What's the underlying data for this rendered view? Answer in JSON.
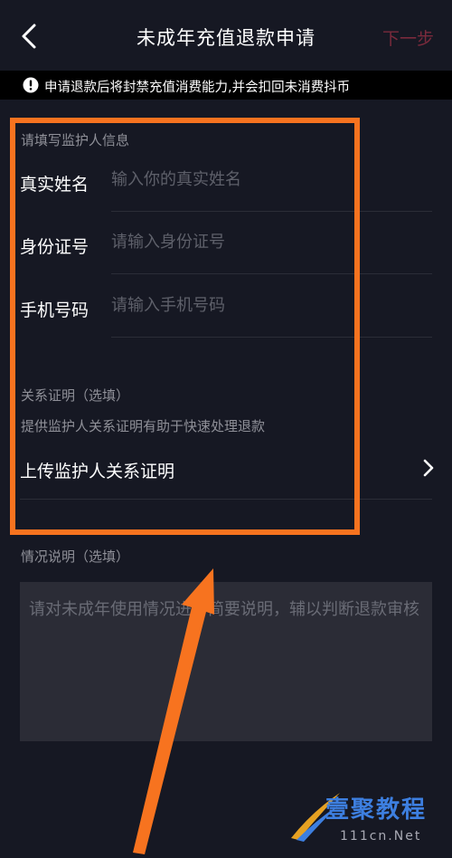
{
  "header": {
    "title": "未成年充值退款申请",
    "next_label": "下一步"
  },
  "notice": {
    "text": "申请退款后将封禁充值消费能力,并会扣回未消费抖币"
  },
  "guardian_section": {
    "hint": "请填写监护人信息",
    "fields": [
      {
        "label": "真实姓名",
        "placeholder": "输入你的真实姓名",
        "value": ""
      },
      {
        "label": "身份证号",
        "placeholder": "请输入身份证号",
        "value": ""
      },
      {
        "label": "手机号码",
        "placeholder": "请输入手机号码",
        "value": ""
      }
    ]
  },
  "relation_section": {
    "title": "关系证明（选填）",
    "desc": "提供监护人关系证明有助于快速处理退款",
    "upload_label": "上传监护人关系证明"
  },
  "situation_section": {
    "title": "情况说明（选填）",
    "placeholder": "请对未成年使用情况进行简要说明，辅以判断退款审核",
    "value": ""
  },
  "watermark": {
    "main": "壹聚教程",
    "sub": "111cn.Net"
  },
  "colors": {
    "background": "#161823",
    "accent_next": "#7a2a3c",
    "highlight": "#f7731f",
    "watermark": "#3d7fe0"
  },
  "icons": {
    "back": "chevron-left-icon",
    "notice": "exclamation-circle-icon",
    "upload": "chevron-right-icon"
  }
}
